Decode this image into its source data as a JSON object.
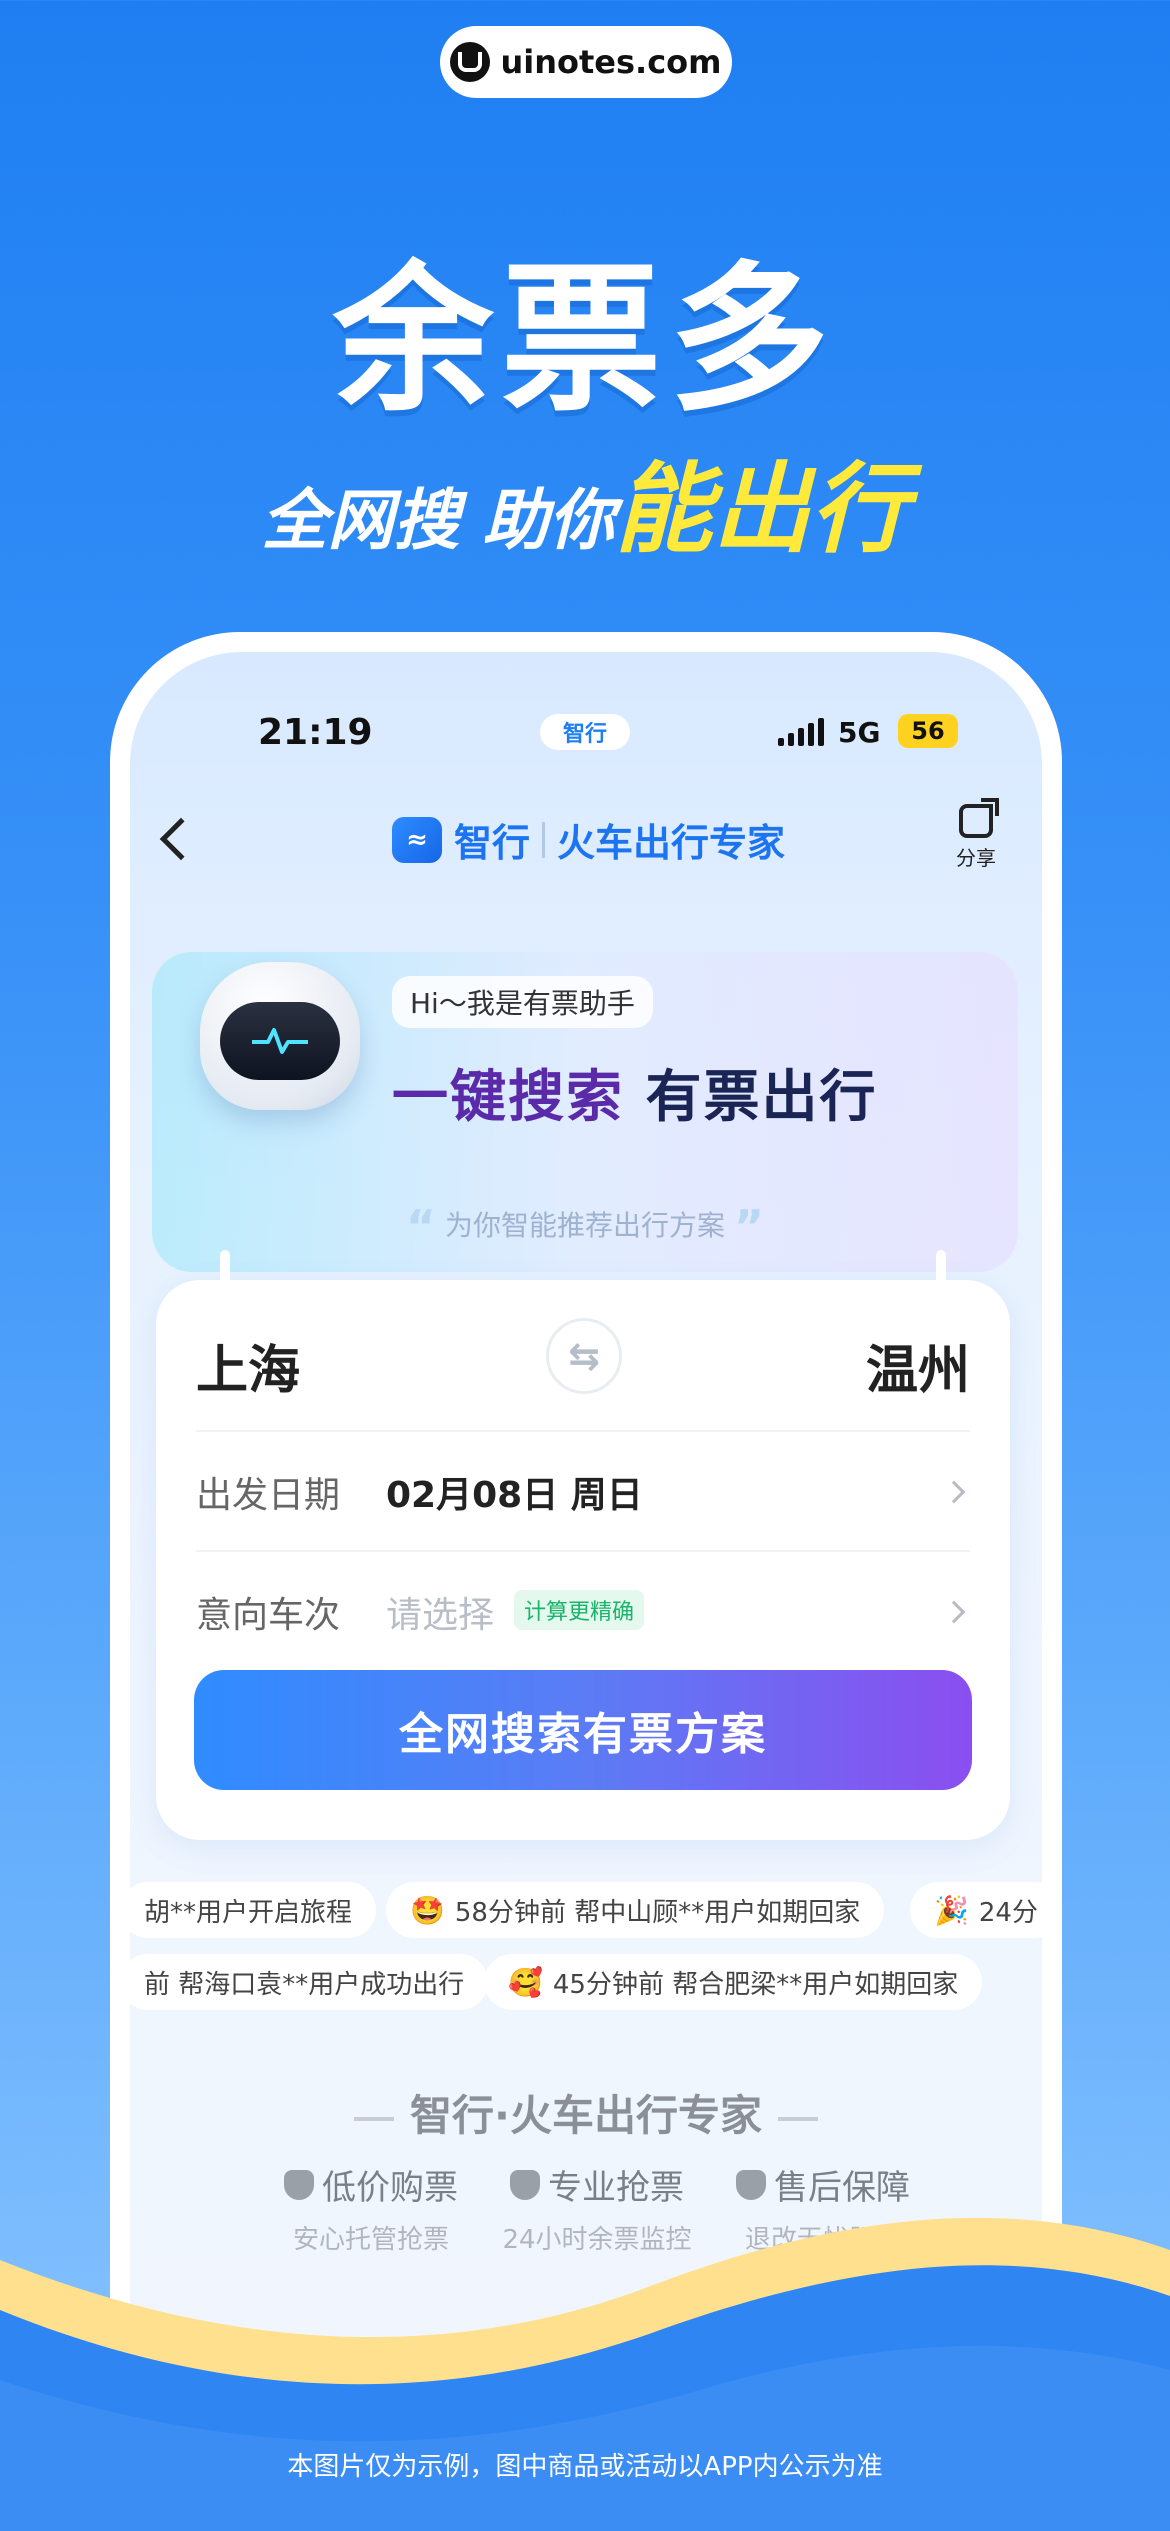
{
  "watermark": {
    "text": "uinotes.com"
  },
  "headline": {
    "title": "余票多",
    "subtitle_prefix": "全网搜 助你",
    "subtitle_highlight": "能出行"
  },
  "status_bar": {
    "time": "21:19",
    "app_badge": "智行",
    "network": "5G",
    "battery": "56"
  },
  "navbar": {
    "brand_name": "智行",
    "slogan": "火车出行专家",
    "share_label": "分享"
  },
  "assistant": {
    "greeting": "Hi～我是有票助手",
    "title_part1": "一键搜索",
    "title_part2": " 有票出行",
    "subtitle": "为你智能推荐出行方案"
  },
  "search": {
    "from_city": "上海",
    "to_city": "温州",
    "date_label": "出发日期",
    "date_value": "02月08日 周日",
    "train_label": "意向车次",
    "train_placeholder": "请选择",
    "train_tag": "计算更精确",
    "button_label": "全网搜索有票方案"
  },
  "ticker_row1": [
    {
      "emoji": "",
      "text": "胡**用户开启旅程"
    },
    {
      "emoji": "🤩",
      "text": "58分钟前 帮中山顾**用户如期回家"
    },
    {
      "emoji": "🎉",
      "text": "24分"
    }
  ],
  "ticker_row2": [
    {
      "emoji": "",
      "text": "前 帮海口袁**用户成功出行"
    },
    {
      "emoji": "🥰",
      "text": "45分钟前 帮合肥梁**用户如期回家"
    }
  ],
  "footer": {
    "title": "智行·火车出行专家",
    "features": [
      {
        "title": "低价购票",
        "sub": "安心托管抢票"
      },
      {
        "title": "专业抢票",
        "sub": "24小时余票监控"
      },
      {
        "title": "售后保障",
        "sub": "退改无忧服务"
      }
    ]
  },
  "disclaimer": "本图片仅为示例，图中商品或活动以APP内公示为准"
}
